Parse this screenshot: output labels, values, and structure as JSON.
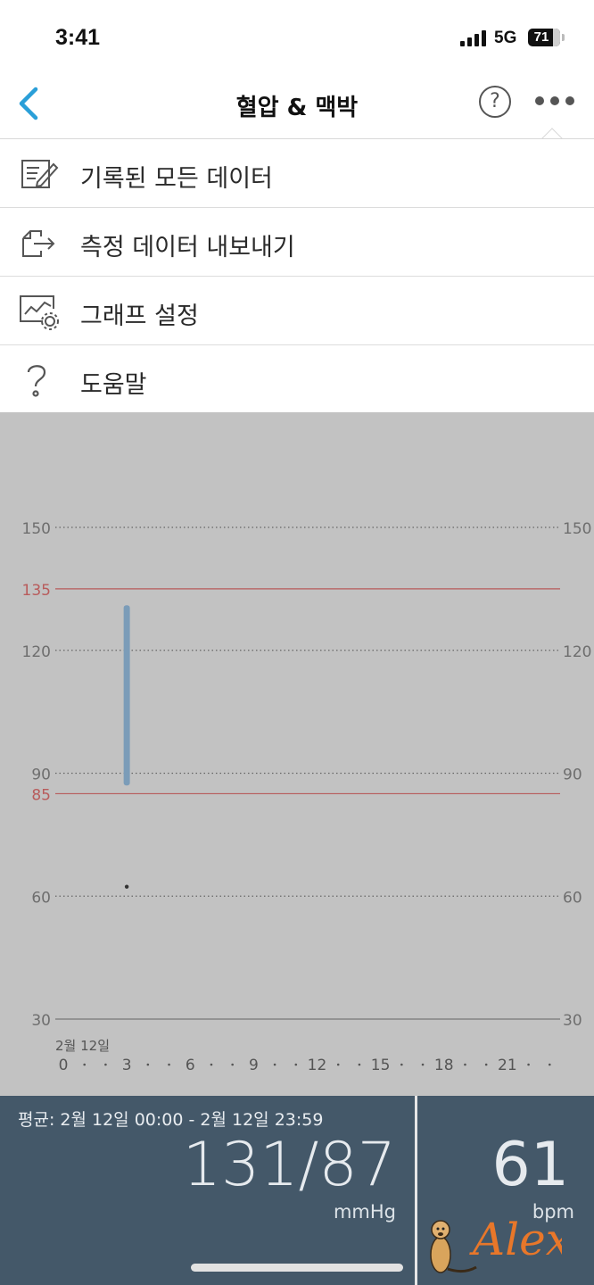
{
  "status_bar": {
    "time": "3:41",
    "network": "5G",
    "battery": "71"
  },
  "nav": {
    "title": "혈압 & 맥박",
    "back_icon": "chevron-left-icon",
    "help_icon": "question-circle-icon",
    "more_icon": "more-horizontal-icon"
  },
  "menu": {
    "items": [
      {
        "label": "기록된 모든 데이터",
        "icon": "edit-list-icon"
      },
      {
        "label": "측정 데이터 내보내기",
        "icon": "export-icon"
      },
      {
        "label": "그래프 설정",
        "icon": "chart-settings-icon"
      },
      {
        "label": "도움말",
        "icon": "question-icon"
      }
    ]
  },
  "chart_data": {
    "type": "range-bar",
    "xlabel": "",
    "ylabel": "",
    "ylim": [
      30,
      150
    ],
    "y_ticks": [
      30,
      60,
      90,
      120,
      150
    ],
    "y_ticks_right": [
      30,
      60,
      90,
      120,
      150
    ],
    "reference_lines": [
      {
        "value": 135,
        "label": "135",
        "color": "#b85b5b"
      },
      {
        "value": 85,
        "label": "85",
        "color": "#b85b5b"
      }
    ],
    "date_label": "2월 12일",
    "x_range": [
      0,
      24
    ],
    "x_ticks": [
      0,
      3,
      6,
      9,
      12,
      15,
      18,
      21
    ],
    "x_tick_labels": [
      "0",
      "3",
      "6",
      "9",
      "12",
      "15",
      "18",
      "21"
    ],
    "series": [
      {
        "name": "",
        "type": "range",
        "color": "#7b9cb8",
        "points": [
          {
            "x": 3,
            "low": 87,
            "high": 131
          }
        ]
      },
      {
        "name": "",
        "type": "point",
        "color": "#333333",
        "points": [
          {
            "x": 3,
            "y": 61
          }
        ]
      }
    ],
    "grid": true
  },
  "stats": {
    "average_label": "평균: 2월 12일 00:00 - 2월 12일 23:59",
    "bp_value": "131/87",
    "bp_unit": "mmHg",
    "pulse_value": "61",
    "pulse_unit": "bpm"
  },
  "watermark": {
    "text": "Alex",
    "icon": "meerkat-icon"
  }
}
